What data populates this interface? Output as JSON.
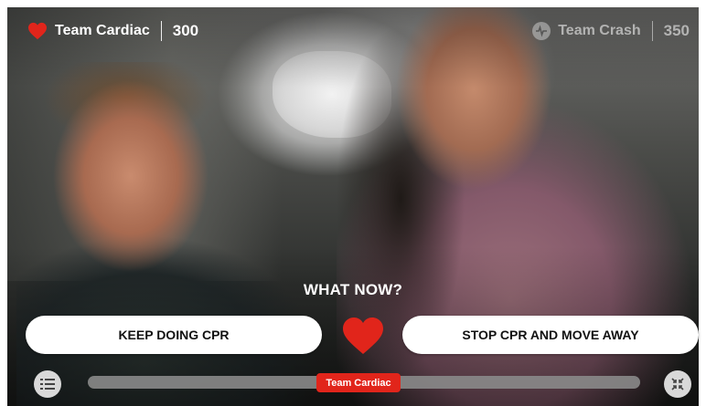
{
  "header": {
    "left_team": {
      "name": "Team Cardiac",
      "score": "300",
      "icon": "heart-icon"
    },
    "right_team": {
      "name": "Team Crash",
      "score": "350",
      "icon": "pulse-icon"
    }
  },
  "prompt": {
    "text": "WHAT NOW?"
  },
  "choices": [
    {
      "label": "KEEP DOING CPR"
    },
    {
      "label": "STOP CPR AND MOVE AWAY"
    }
  ],
  "progress": {
    "team_label": "Team Cardiac",
    "position_fraction": 0.49
  },
  "controls": {
    "menu_icon": "menu-list-icon",
    "collapse_icon": "collapse-icon"
  },
  "colors": {
    "accent": "#e1251b",
    "white": "#ffffff",
    "track": "#8a8a8a"
  }
}
